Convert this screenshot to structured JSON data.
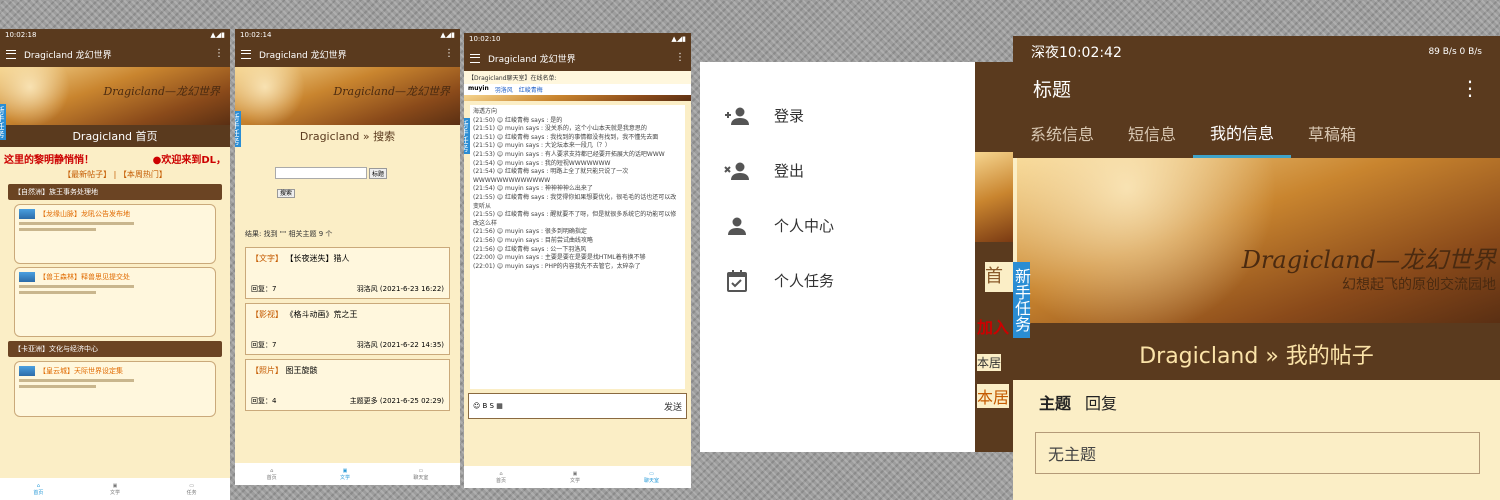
{
  "phone1": {
    "time": "10:02:18",
    "app_title": "Dragicland 龙幻世界",
    "page_title": "Dragicland 首页",
    "marquee_left": "这里的黎明静悄悄！",
    "marquee_right": "●欢迎来到DL，",
    "links_new": "【最新帖子】",
    "links_hot": "【本周热门】",
    "forum1_head": "【自然洲】族王事务处理地",
    "forum1_card1": "【龙缘山脉】龙吼公告发布地",
    "forum1_card2": "【兽王森林】释兽思见提交处",
    "forum2_head": "【卡亚洲】文化与经济中心",
    "forum2_card1": "【皇云城】天际世界设定集",
    "side_tab": "新手任务",
    "tabs": [
      "首页",
      "文学",
      "任务"
    ]
  },
  "phone2": {
    "time": "10:02:14",
    "app_title": "Dragicland 龙幻世界",
    "page_title": "Dragicland » 搜索",
    "search_btn": "标题",
    "search_btn2": "搜索",
    "result_meta": "结果: 找到 \"\" 相关主题 9 个",
    "results": [
      {
        "tag": "【文字】",
        "title": "【长夜迷失】猎人",
        "replies": "回复：7",
        "author": "羽洛风 (2021-6-23 16:22)"
      },
      {
        "tag": "【影视】",
        "title": "《格斗动画》荒之王",
        "replies": "回复：7",
        "author": "羽洛风 (2021-6-22 14:35)"
      },
      {
        "tag": "【照片】",
        "title": "图王旋骸",
        "replies": "回复：4",
        "author": "主题更多 (2021-6-25 02:29)"
      }
    ],
    "side_tab": "新手任务",
    "tabs": [
      "首页",
      "文学",
      "聊天室"
    ]
  },
  "phone3": {
    "time": "10:02:10",
    "app_title": "Dragicland 龙幻世界",
    "chat_head": "【Dragicland聊天室】在线名单:",
    "chat_users": [
      "muyin",
      "羽洛风",
      "红峻青梅"
    ],
    "messages": [
      "海透方向",
      "(21:50) ☺ 红峻青梅 says : 是的",
      "(21:51) ☺ muyin says : 没关系的，这个小山本天就是我意思的",
      "(21:51) ☺ 红峻青梅 says : 我找到的事情都没有找到，我不懂先去面",
      "(21:51) ☺ muyin says : 大论坛本来一段几（？）",
      "(21:53) ☺ muyin says : 有人要求支持都已经要开拓展大的话吧WWW",
      "(21:54) ☺ muyin says : 我的短视WWWWWWW",
      "(21:54) ☺ 红峻青梅 says : 明路上全了就只能只说了一次WWWWWWWWWWWWW",
      "(21:54) ☺ muyin says : 神神神神么出来了",
      "(21:55) ☺ 红峻青梅 says : 我觉得你如果想要优化，很毛毛的话也还可以改变听从",
      "(21:55) ☺ 红峻青梅 says : 醒就要不了呀，但是就很多系统它的功能可以修改这么样",
      "(21:56) ☺ muyin says : 很多到明确指定",
      "(21:56) ☺ muyin says : 目前尝试曲线攻略",
      "(21:56) ☺ 红峻青梅 says : 公一下羽洛风",
      "(22:00) ☺ muyin says : 主要是要在是要是找HTML着有换不够",
      "(22:01) ☺ muyin says : PHP的内容我先不去管它，太碎杂了"
    ],
    "send": "发送",
    "side_tab": "新手任务",
    "tabs": [
      "首页",
      "文学",
      "聊天室"
    ]
  },
  "menu": {
    "items": [
      {
        "label": "登录",
        "icon": "person-add-icon"
      },
      {
        "label": "登出",
        "icon": "person-remove-icon"
      },
      {
        "label": "个人中心",
        "icon": "person-icon"
      },
      {
        "label": "个人任务",
        "icon": "calendar-check-icon"
      }
    ],
    "bg_text1": "首",
    "bg_text2": "加入",
    "bg_text3": "本居",
    "bg_text4": "本居"
  },
  "phone4": {
    "status_left": "深夜10:02:42",
    "net_speed": "89 B/s 0 B/s",
    "app_title": "标题",
    "tabs": [
      "系统信息",
      "短信息",
      "我的信息",
      "草稿箱"
    ],
    "active_tab": "我的信息",
    "banner_brand": "Dragicland—龙幻世界",
    "banner_sub": "幻想起飞的原创交流园地",
    "page_title": "Dragicland » 我的帖子",
    "sub_tabs": [
      "主题",
      "回复"
    ],
    "input_value": "无主题",
    "side_tab": "新手任务"
  }
}
